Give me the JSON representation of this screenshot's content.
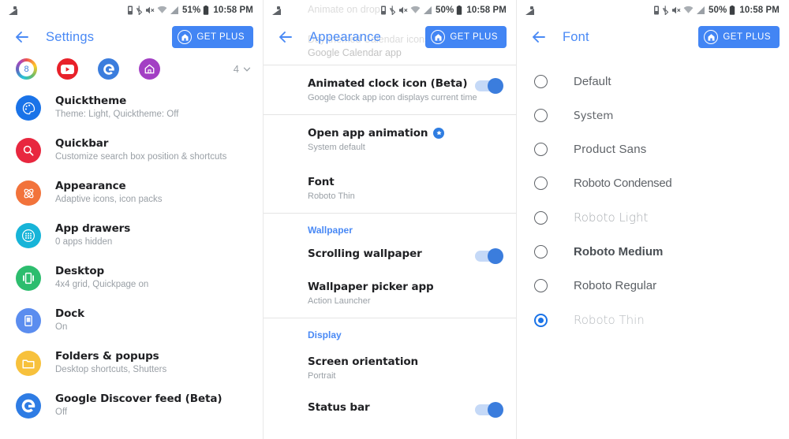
{
  "colors": {
    "accent_blue": "#4285f4",
    "title_blue": "#4989f5",
    "section_blue": "#4989f5",
    "toggle_on": "#3b7ddd",
    "radio_selected": "#1a73e8",
    "title_text": "#202124",
    "subtitle_text": "#9aa0a6"
  },
  "panels": [
    {
      "id": "settings",
      "statusbar": {
        "corner_icon": "notification-glyph-icon",
        "icons": [
          "vibrate-icon",
          "bluetooth-icon",
          "mute-icon",
          "wifi-icon",
          "signal-icon"
        ],
        "battery_percent": "51%",
        "battery_icon": "battery-icon",
        "time": "10:58 PM"
      },
      "appbar": {
        "back_icon": "back-arrow-icon",
        "title": "Settings",
        "get_plus_label": "GET PLUS",
        "get_plus_icon": "home-circle-icon"
      },
      "icon_row": {
        "icons": [
          {
            "name": "rainbow-ring-8-icon",
            "label": "8"
          },
          {
            "name": "youtube-icon",
            "label": ""
          },
          {
            "name": "google-icon",
            "label": "G"
          },
          {
            "name": "home-purple-icon",
            "label": ""
          }
        ],
        "count": "4",
        "chevron_icon": "chevron-down-icon"
      },
      "items": [
        {
          "icon": "palette-icon",
          "color": "#1a73e8",
          "title": "Quicktheme",
          "subtitle": "Theme: Light, Quicktheme: Off"
        },
        {
          "icon": "search-icon",
          "color": "#e8273f",
          "title": "Quickbar",
          "subtitle": "Customize search box position & shortcuts"
        },
        {
          "icon": "atom-icon",
          "color": "#f2733b",
          "title": "Appearance",
          "subtitle": "Adaptive icons, icon packs"
        },
        {
          "icon": "app-grid-icon",
          "color": "#17b4d8",
          "title": "App drawers",
          "subtitle": "0 apps hidden"
        },
        {
          "icon": "desktop-icon",
          "color": "#2dbd6e",
          "title": "Desktop",
          "subtitle": "4x4 grid, Quickpage on"
        },
        {
          "icon": "dock-icon",
          "color": "#5b8def",
          "title": "Dock",
          "subtitle": "On"
        },
        {
          "icon": "folder-icon",
          "color": "#f7c13c",
          "title": "Folders & popups",
          "subtitle": "Desktop shortcuts, Shutters"
        },
        {
          "icon": "google-g-icon",
          "color": "#2e7ce4",
          "title": "Google Discover feed (Beta)",
          "subtitle": "Off"
        }
      ]
    },
    {
      "id": "appearance",
      "statusbar": {
        "corner_icon": "notification-glyph-icon",
        "icons": [
          "vibrate-icon",
          "bluetooth-icon",
          "mute-icon",
          "wifi-icon",
          "signal-icon"
        ],
        "battery_percent": "50%",
        "battery_icon": "battery-icon",
        "time": "10:58 PM"
      },
      "appbar": {
        "back_icon": "back-arrow-icon",
        "title": "Appearance",
        "get_plus_label": "GET PLUS",
        "get_plus_icon": "home-circle-icon"
      },
      "scroll_ghosts": {
        "top_partial": "Animate on drop",
        "mid_partial": "Day themed Calendar icons",
        "clipped_subtitle": "Google Calendar app"
      },
      "rows": [
        {
          "type": "toggle",
          "title": "Animated clock icon (Beta)",
          "subtitle": "Google Clock app icon displays current time",
          "toggle_on": true
        },
        {
          "type": "plain",
          "title": "Open app animation",
          "subtitle": "System default",
          "plus_badge": true
        },
        {
          "type": "plain",
          "title": "Font",
          "subtitle": "Roboto Thin"
        },
        {
          "type": "section",
          "label": "Wallpaper"
        },
        {
          "type": "toggle",
          "title": "Scrolling wallpaper",
          "subtitle": "",
          "toggle_on": true
        },
        {
          "type": "plain",
          "title": "Wallpaper picker app",
          "subtitle": "Action Launcher"
        },
        {
          "type": "section",
          "label": "Display"
        },
        {
          "type": "plain",
          "title": "Screen orientation",
          "subtitle": "Portrait"
        },
        {
          "type": "toggle",
          "title": "Status bar",
          "subtitle": "",
          "toggle_on": true
        }
      ]
    },
    {
      "id": "font",
      "statusbar": {
        "corner_icon": "notification-glyph-icon",
        "icons": [
          "vibrate-icon",
          "bluetooth-icon",
          "mute-icon",
          "wifi-icon",
          "signal-icon"
        ],
        "battery_percent": "50%",
        "battery_icon": "battery-icon",
        "time": "10:58 PM"
      },
      "appbar": {
        "back_icon": "back-arrow-icon",
        "title": "Font",
        "get_plus_label": "GET PLUS",
        "get_plus_icon": "home-circle-icon"
      },
      "options": [
        {
          "label": "Default",
          "selected": false,
          "style": "f-default"
        },
        {
          "label": "System",
          "selected": false,
          "style": "f-system"
        },
        {
          "label": "Product Sans",
          "selected": false,
          "style": "f-product"
        },
        {
          "label": "Roboto Condensed",
          "selected": false,
          "style": "f-cond"
        },
        {
          "label": "Roboto Light",
          "selected": false,
          "style": "f-light"
        },
        {
          "label": "Roboto Medium",
          "selected": false,
          "style": "f-medium"
        },
        {
          "label": "Roboto Regular",
          "selected": false,
          "style": "f-regular"
        },
        {
          "label": "Roboto Thin",
          "selected": true,
          "style": "f-thin"
        }
      ]
    }
  ]
}
